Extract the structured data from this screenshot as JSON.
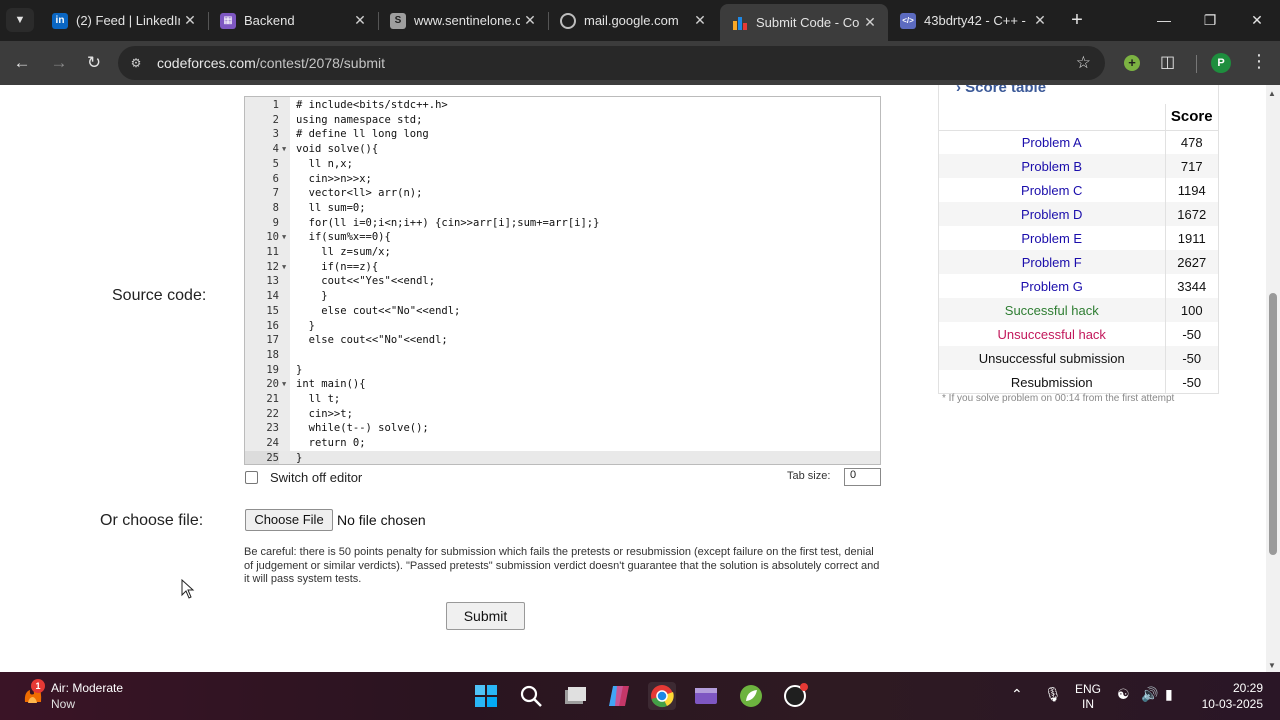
{
  "browser": {
    "tabs": [
      {
        "label": "(2) Feed | LinkedIn",
        "icon": "linkedin-icon",
        "color": "#0a66c2"
      },
      {
        "label": "Backend",
        "icon": "document-icon",
        "color": "#7e57c2"
      },
      {
        "label": "www.sentinelone.c",
        "icon": "sentinelone-icon",
        "color": "#9e9e9e"
      },
      {
        "label": "mail.google.com",
        "icon": "globe-icon",
        "color": "#9e9e9e"
      },
      {
        "label": "Submit Code - Co",
        "icon": "codeforces-icon",
        "color": "#1e88e5"
      },
      {
        "label": "43bdrty42 - C++ -",
        "icon": "code-icon",
        "color": "#5c6bc0"
      }
    ],
    "active_tab_index": 4,
    "url_host": "codeforces.com",
    "url_path": "/contest/2078/submit",
    "profile_initial": "P"
  },
  "editor": {
    "label": "Source code:",
    "lines": [
      "# include<bits/stdc++.h>",
      "using namespace std;",
      "# define ll long long",
      "void solve(){",
      "  ll n,x;",
      "  cin>>n>>x;",
      "  vector<ll> arr(n);",
      "  ll sum=0;",
      "  for(ll i=0;i<n;i++) {cin>>arr[i];sum+=arr[i];}",
      "  if(sum%x==0){",
      "    ll z=sum/x;",
      "    if(n==z){",
      "    cout<<\"Yes\"<<endl;",
      "    }",
      "    else cout<<\"No\"<<endl;",
      "  }",
      "  else cout<<\"No\"<<endl;",
      "",
      "}",
      "int main(){",
      "  ll t;",
      "  cin>>t;",
      "  while(t--) solve();",
      "  return 0;",
      "}"
    ],
    "fold_lines": [
      4,
      10,
      12,
      20
    ],
    "active_line": 25,
    "switch_off_label": "Switch off editor",
    "tab_size_label": "Tab size:",
    "tab_size_value": "0"
  },
  "file": {
    "label": "Or choose file:",
    "button": "Choose File",
    "status": "No file chosen"
  },
  "warning": "Be careful: there is 50 points penalty for submission which fails the pretests or resubmission (except failure on the first test, denial of judgement or similar verdicts). \"Passed pretests\" submission verdict doesn't guarantee that the solution is absolutely correct and it will pass system tests.",
  "submit_label": "Submit",
  "score_table": {
    "title": "Score table",
    "header_score": "Score",
    "rows": [
      {
        "name": "Problem A",
        "score": "478",
        "kind": "link"
      },
      {
        "name": "Problem B",
        "score": "717",
        "kind": "link"
      },
      {
        "name": "Problem C",
        "score": "1194",
        "kind": "link"
      },
      {
        "name": "Problem D",
        "score": "1672",
        "kind": "link"
      },
      {
        "name": "Problem E",
        "score": "1911",
        "kind": "link"
      },
      {
        "name": "Problem F",
        "score": "2627",
        "kind": "link"
      },
      {
        "name": "Problem G",
        "score": "3344",
        "kind": "link"
      },
      {
        "name": "Successful hack",
        "score": "100",
        "kind": "ok"
      },
      {
        "name": "Unsuccessful hack",
        "score": "-50",
        "kind": "bad"
      },
      {
        "name": "Unsuccessful submission",
        "score": "-50",
        "kind": "plain"
      },
      {
        "name": "Resubmission",
        "score": "-50",
        "kind": "plain"
      }
    ],
    "note": "* If you solve problem on 00:14 from the first attempt"
  },
  "taskbar": {
    "weather_title": "Air: Moderate",
    "weather_sub": "Now",
    "weather_badge": "1",
    "lang_top": "ENG",
    "lang_bottom": "IN",
    "time": "20:29",
    "date": "10-03-2025"
  }
}
